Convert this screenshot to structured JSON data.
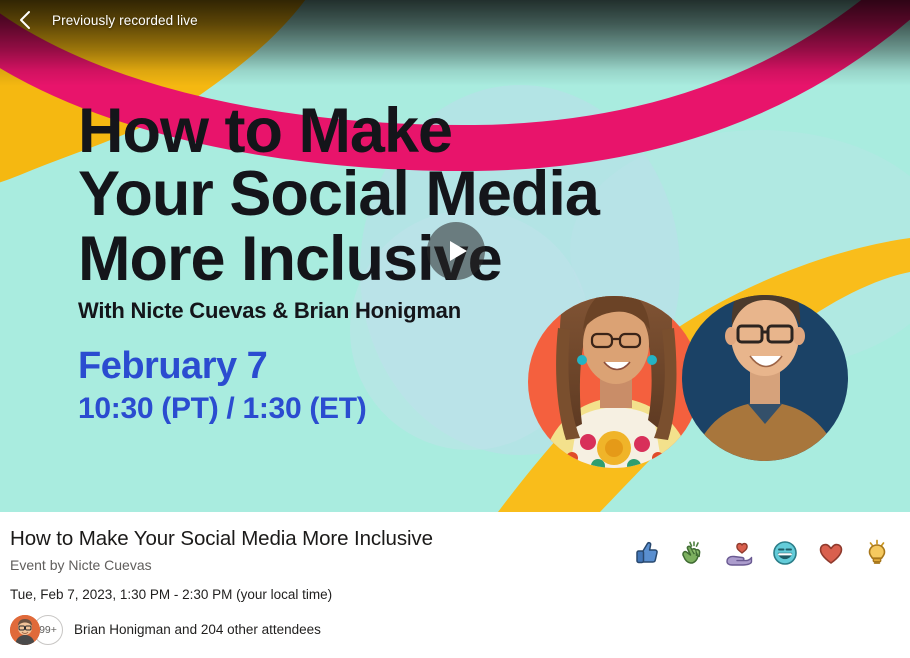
{
  "top_bar": {
    "back_icon": "chevron-left-icon",
    "status_label": "Previously recorded live"
  },
  "player": {
    "play_icon": "play-icon"
  },
  "banner": {
    "headline_line1": "How to Make",
    "headline_line2": "Your Social Media",
    "headline_line3": "More Inclusive",
    "presenters": "With Nicte Cuevas & Brian Honigman",
    "date": "February 7",
    "time": "10:30 (PT) / 1:30 (ET)",
    "colors": {
      "mint": "#a9ecdf",
      "yellow": "#f5b811",
      "pink": "#e8146b",
      "blue_text": "#2b4cd0",
      "headline_text": "#14151a",
      "photo_left_circle": "#f4603e",
      "photo_right_circle": "#1b4266",
      "pale_blue_blob": "#b9dce8"
    }
  },
  "info": {
    "title": "How to Make Your Social Media More Inclusive",
    "organizer": "Event by Nicte Cuevas",
    "datetime": "Tue, Feb 7, 2023, 1:30 PM - 2:30 PM (your local time)",
    "attendee_overflow_count": "99+",
    "attendees_label": "Brian Honigman and 204 other attendees"
  },
  "reactions": [
    {
      "name": "thumbs-up-reaction",
      "icon": "thumbs-up-icon",
      "color": "#4a7fc1"
    },
    {
      "name": "applause-reaction",
      "icon": "clapping-hands-icon",
      "color": "#6fa55a"
    },
    {
      "name": "heart-hand-reaction",
      "icon": "heart-in-hand-icon",
      "color": "#a08fc4"
    },
    {
      "name": "laugh-reaction",
      "icon": "laughing-face-icon",
      "color": "#5bc8d8"
    },
    {
      "name": "love-reaction",
      "icon": "heart-icon",
      "color": "#d9604e"
    },
    {
      "name": "insight-reaction",
      "icon": "lightbulb-icon",
      "color": "#f2c14e"
    }
  ]
}
